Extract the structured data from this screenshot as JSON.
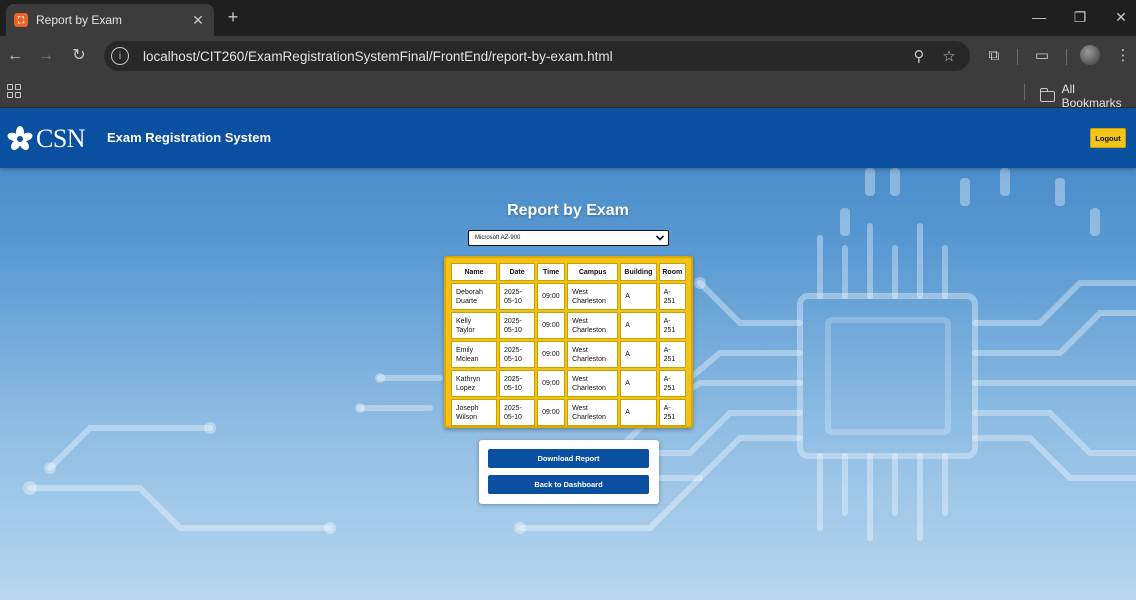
{
  "browser": {
    "tab_title": "Report by Exam",
    "favicon_label": "⛶",
    "url": "localhost/CIT260/ExamRegistrationSystemFinal/FrontEnd/report-by-exam.html",
    "bookmarks_folder": "All Bookmarks"
  },
  "header": {
    "logo_text": "CSN",
    "title": "Exam Registration System",
    "logout_label": "Logout"
  },
  "page": {
    "heading": "Report by Exam",
    "exam_select": {
      "selected": "Microsoft AZ-900"
    }
  },
  "report": {
    "columns": [
      "Name",
      "Date",
      "Time",
      "Campus",
      "Building",
      "Room"
    ],
    "rows": [
      {
        "name_first": "Deborah",
        "name_last": "Duarte",
        "date_year": "2025-",
        "date_md": "05-10",
        "time": "09:00",
        "campus_1": "West",
        "campus_2": "Charleston",
        "building": "A",
        "room": "A-251"
      },
      {
        "name_first": "Kelly",
        "name_last": "Taylor",
        "date_year": "2025-",
        "date_md": "05-10",
        "time": "09:00",
        "campus_1": "West",
        "campus_2": "Charleston",
        "building": "A",
        "room": "A-251"
      },
      {
        "name_first": "Emily",
        "name_last": "Mclean",
        "date_year": "2025-",
        "date_md": "05-10",
        "time": "09:00",
        "campus_1": "West",
        "campus_2": "Charleston",
        "building": "A",
        "room": "A-251"
      },
      {
        "name_first": "Kathryn",
        "name_last": "Lopez",
        "date_year": "2025-",
        "date_md": "05-10",
        "time": "09:00",
        "campus_1": "West",
        "campus_2": "Charleston",
        "building": "A",
        "room": "A-251"
      },
      {
        "name_first": "Joseph",
        "name_last": "Wilson",
        "date_year": "2025-",
        "date_md": "05-10",
        "time": "09:00",
        "campus_1": "West",
        "campus_2": "Charleston",
        "building": "A",
        "room": "A-251"
      }
    ]
  },
  "actions": {
    "download_label": "Download Report",
    "back_label": "Back to Dashboard"
  },
  "colors": {
    "header_blue": "#0a4fa0",
    "accent_gold": "#f3c21a",
    "button_blue": "#0a4fa0"
  },
  "icons": {
    "tab_favicon": "xampp-icon",
    "site_info": "site-info-icon",
    "zoom": "zoom-icon",
    "bookmark": "star-icon",
    "extensions": "puzzle-icon",
    "media": "media-cast-icon",
    "menu": "kebab-menu-icon"
  }
}
